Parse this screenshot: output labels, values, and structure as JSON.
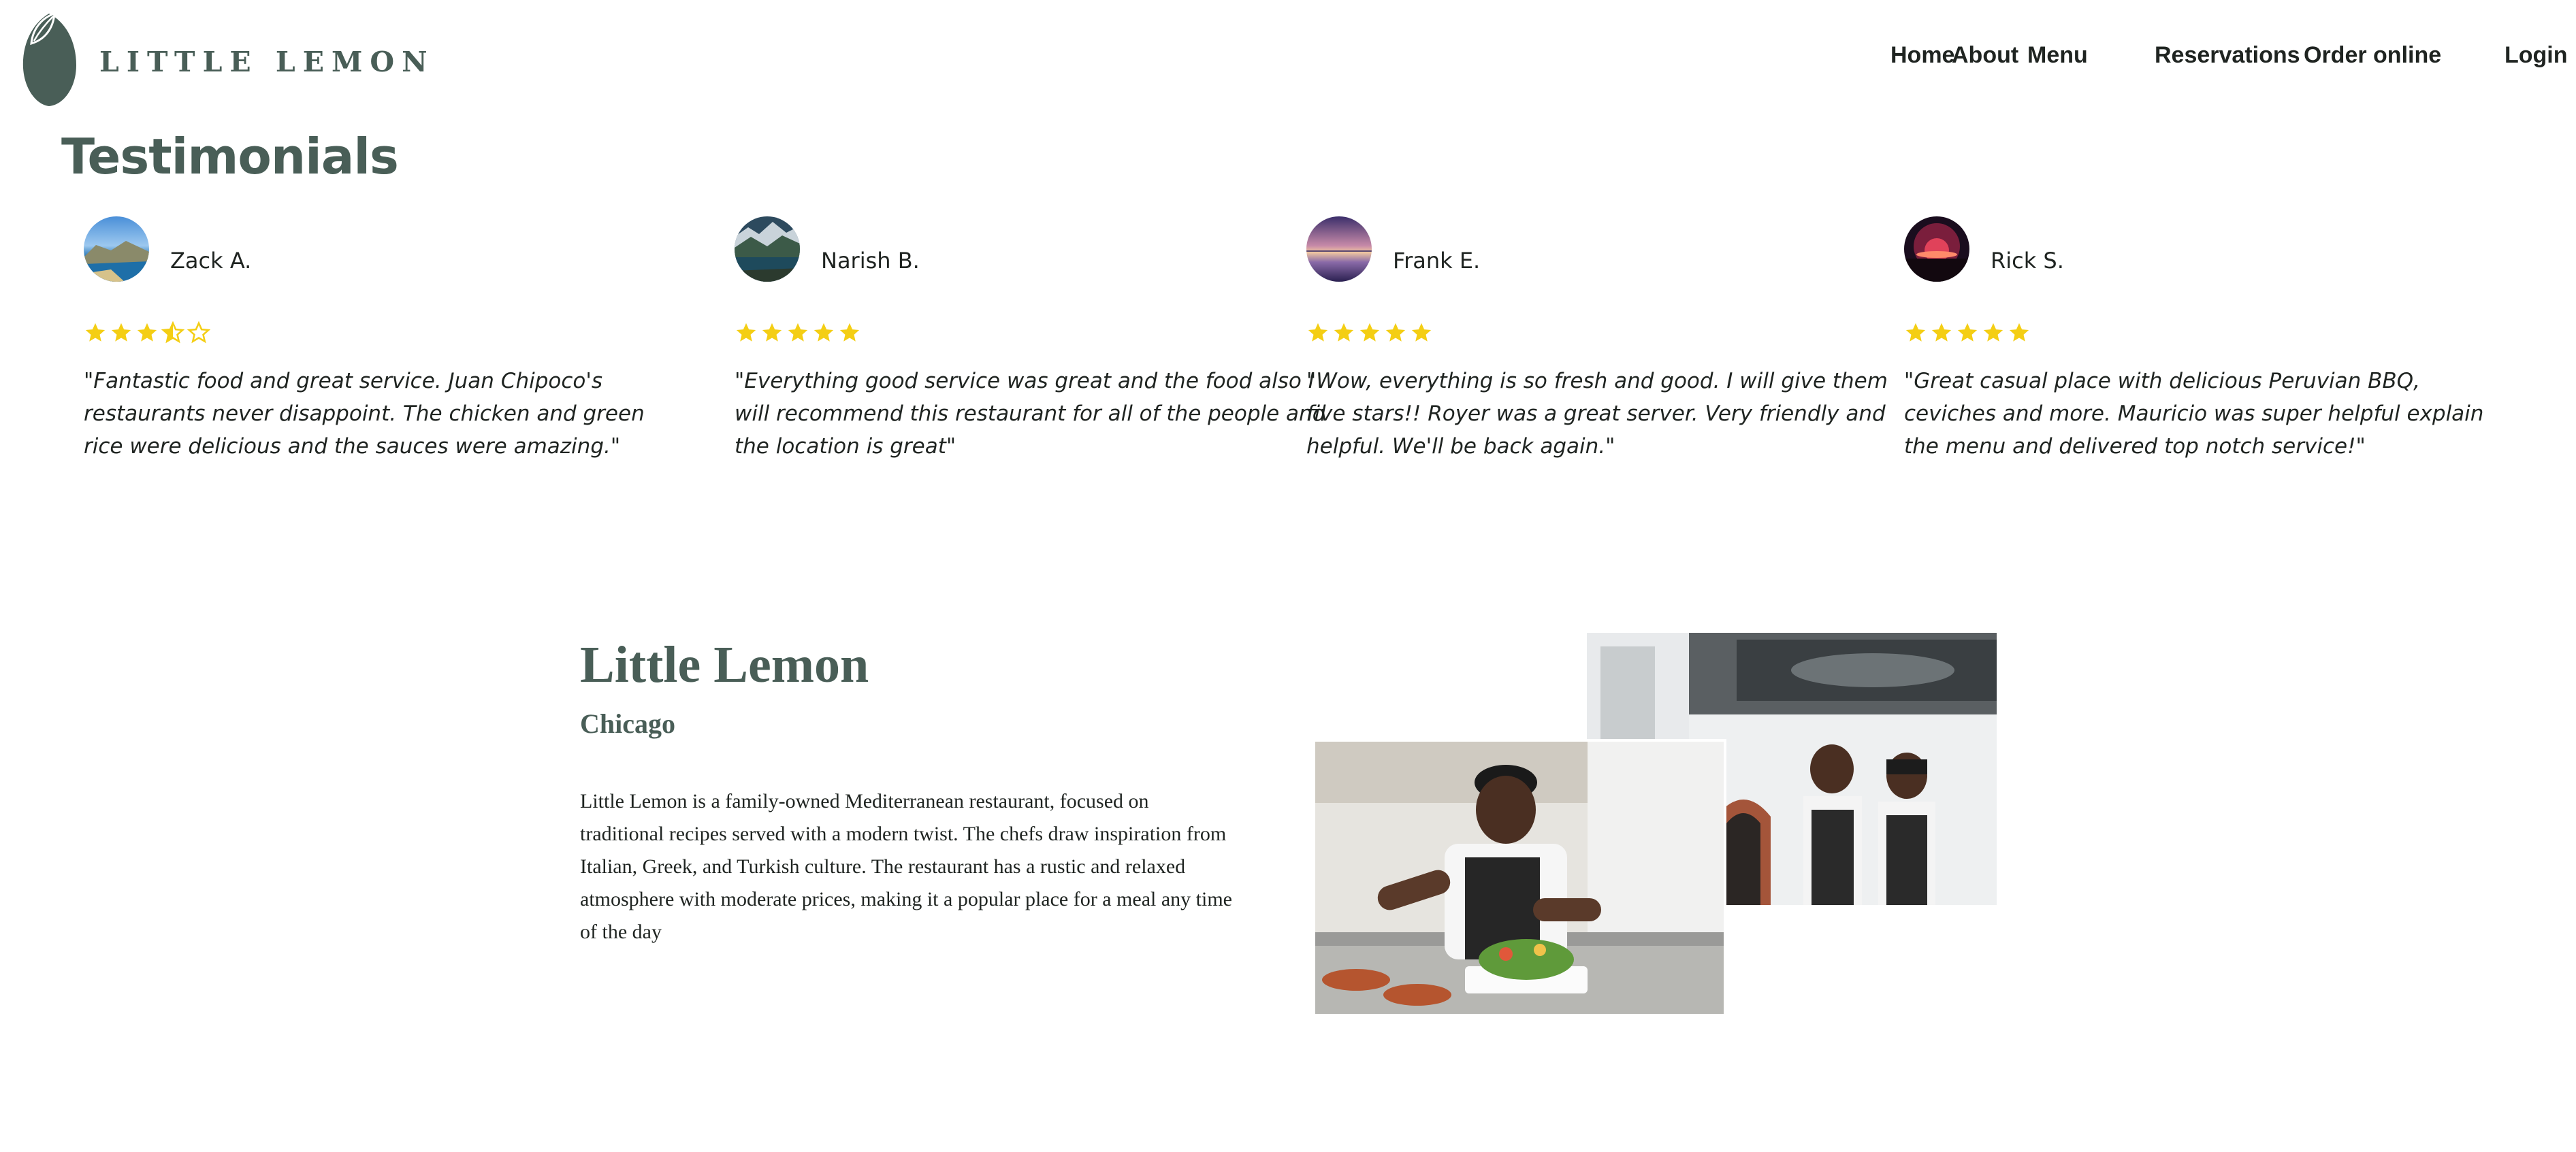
{
  "brand": {
    "name": "LITTLE LEMON",
    "logo_icon": "lemon-icon",
    "color": "#495e57"
  },
  "nav": {
    "items": [
      {
        "label": "Home"
      },
      {
        "label": "About"
      },
      {
        "label": "Menu"
      },
      {
        "label": "Reservations"
      },
      {
        "label": "Order online"
      },
      {
        "label": "Login"
      }
    ]
  },
  "testimonials": {
    "title": "Testimonials",
    "star_color": "#f4ce14",
    "items": [
      {
        "name": "Zack A.",
        "rating": 3.5,
        "max_rating": 5,
        "avatar": "coastal-island-photo",
        "quote": "\"Fantastic food and great service. Juan Chipoco's restaurants never disappoint. The chicken and green rice were delicious and the sauces were amazing.\""
      },
      {
        "name": "Narish B.",
        "rating": 5,
        "max_rating": 5,
        "avatar": "mountain-lake-photo",
        "quote": "\"Everything good service was great and the food also I will recommend this restaurant for all of the people and the location is great\""
      },
      {
        "name": "Frank E.",
        "rating": 5,
        "max_rating": 5,
        "avatar": "purple-sunset-photo",
        "quote": "\"Wow, everything is so fresh and good. I will give them five stars!! Royer was a great server. Very friendly and helpful. We'll be back again.\""
      },
      {
        "name": "Rick S.",
        "rating": 5,
        "max_rating": 5,
        "avatar": "red-galaxy-photo",
        "quote": "\"Great casual place with delicious Peruvian BBQ, ceviches and more. Mauricio was super helpful explain the menu and delivered top notch service!\""
      }
    ]
  },
  "about": {
    "title": "Little Lemon",
    "subtitle": "Chicago",
    "description": "Little Lemon is a family-owned Mediterranean restaurant, focused on traditional recipes served with a modern twist. The chefs draw inspiration from Italian, Greek, and Turkish culture. The restaurant has a rustic and relaxed atmosphere with moderate prices, making it a popular place for a meal any time of the day",
    "photos": [
      {
        "subject": "two-chefs-in-kitchen-photo"
      },
      {
        "subject": "chef-plating-salad-photo"
      }
    ]
  }
}
